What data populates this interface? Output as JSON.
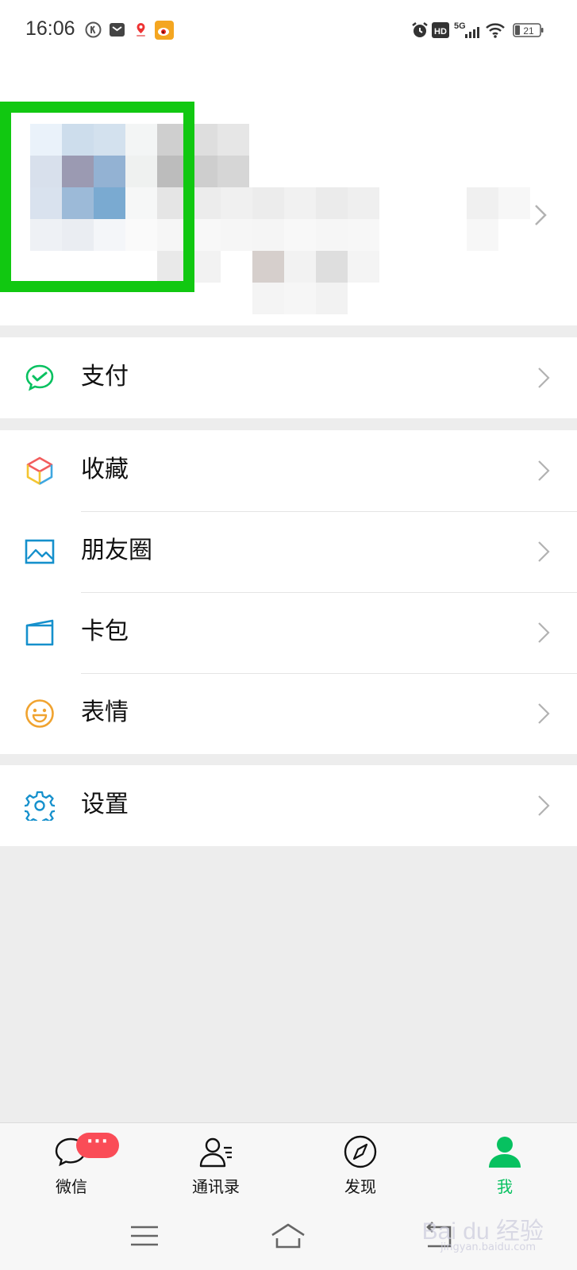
{
  "status_bar": {
    "time": "16:06",
    "battery": "21",
    "network": "5G",
    "hd": "HD"
  },
  "profile": {
    "avatar": "pixelated-avatar",
    "highlight_color": "#11c811"
  },
  "menu": {
    "pay": {
      "label": "支付",
      "icon": "wechat-pay-icon"
    },
    "favorites": {
      "label": "收藏",
      "icon": "cube-icon"
    },
    "moments": {
      "label": "朋友圈",
      "icon": "image-icon"
    },
    "cards": {
      "label": "卡包",
      "icon": "wallet-icon"
    },
    "stickers": {
      "label": "表情",
      "icon": "smiley-icon"
    },
    "settings": {
      "label": "设置",
      "icon": "gear-icon"
    }
  },
  "tabbar": {
    "chats": {
      "label": "微信",
      "badge": "···"
    },
    "contacts": {
      "label": "通讯录"
    },
    "discover": {
      "label": "发现"
    },
    "me": {
      "label": "我",
      "active": true
    }
  },
  "watermark": {
    "text": "Bai du 经验",
    "sub": "jingyan.baidu.com"
  },
  "colors": {
    "accent": "#07c160",
    "badge": "#fa4c57",
    "background": "#ededed"
  }
}
